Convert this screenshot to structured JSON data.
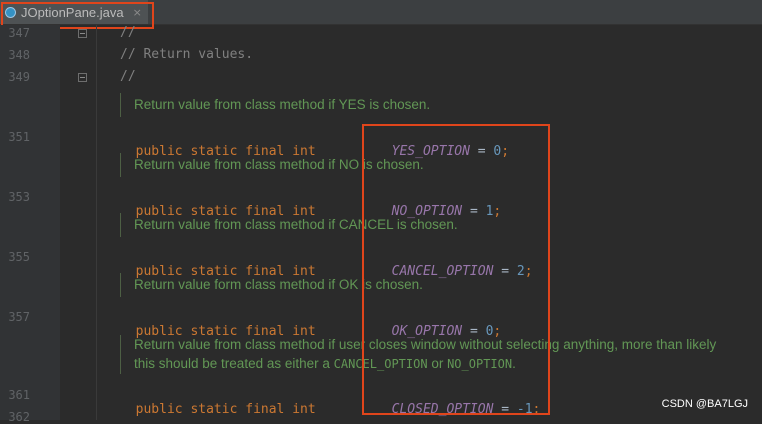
{
  "tab": {
    "label": "JOptionPane.java",
    "close": "×"
  },
  "gutter": {
    "l347": "347",
    "l348": "348",
    "l349": "349",
    "l351": "351",
    "l353": "353",
    "l355": "355",
    "l357": "357",
    "l361": "361",
    "l362": "362"
  },
  "code": {
    "c347": "//",
    "c348": "// Return values.",
    "c349": "//",
    "kw_public": "public",
    "kw_static": "static",
    "kw_final": "final",
    "kw_int": "int",
    "eq": "=",
    "semi": ";",
    "yes_name": "YES_OPTION",
    "yes_val": "0",
    "no_name": "NO_OPTION",
    "no_val": "1",
    "cancel_name": "CANCEL_OPTION",
    "cancel_val": "2",
    "ok_name": "OK_OPTION",
    "ok_val": "0",
    "closed_name": "CLOSED_OPTION",
    "closed_val": "-1"
  },
  "docs": {
    "yes": "Return value from class method if YES is chosen.",
    "no": "Return value from class method if NO is chosen.",
    "cancel": "Return value from class method if CANCEL is chosen.",
    "ok": "Return value form class method if OK is chosen.",
    "closed_1": "Return value from class method if user closes window without selecting anything, more than likely",
    "closed_2a": "this should be treated as either a ",
    "closed_2b": "CANCEL_OPTION",
    "closed_2c": " or ",
    "closed_2d": "NO_OPTION",
    "closed_2e": "."
  },
  "watermark": "CSDN @BA7LGJ",
  "colors": {
    "highlight": "#e0451b",
    "keyword": "#cc7832",
    "constant": "#9876aa",
    "number": "#6897bb",
    "doc": "#629755"
  }
}
